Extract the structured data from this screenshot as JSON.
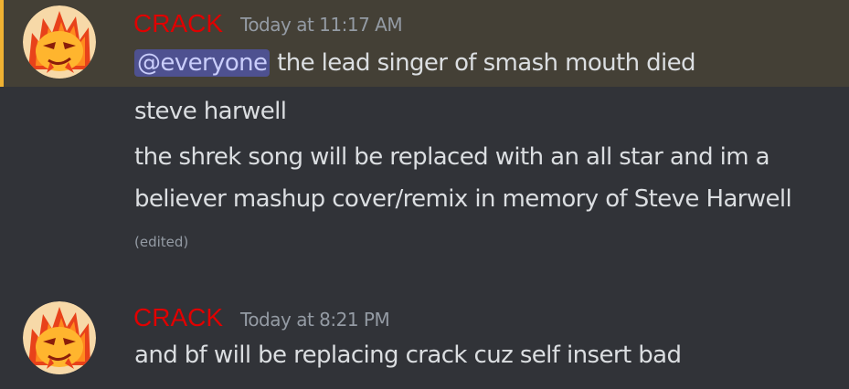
{
  "colors": {
    "background": "#313338",
    "mention_highlight": "#444036",
    "mention_bar": "#f0b232",
    "username": "#e00000",
    "mention_pill": "#4e5190"
  },
  "messages": [
    {
      "username": "CRACK",
      "timestamp": "Today at 11:17 AM",
      "avatar_icon": "flame-face-avatar-icon",
      "mention": "@everyone",
      "first_line": "the lead singer of smash mouth died",
      "lines": [
        "steve harwell",
        "the shrek song will be replaced with an all star and im a",
        "believer mashup cover/remix in memory of Steve Harwell"
      ],
      "edited_label": "(edited)"
    },
    {
      "username": "CRACK",
      "timestamp": "Today at 8:21 PM",
      "avatar_icon": "flame-face-avatar-icon",
      "lines": [
        "and bf will be replacing crack cuz self insert bad"
      ]
    }
  ]
}
